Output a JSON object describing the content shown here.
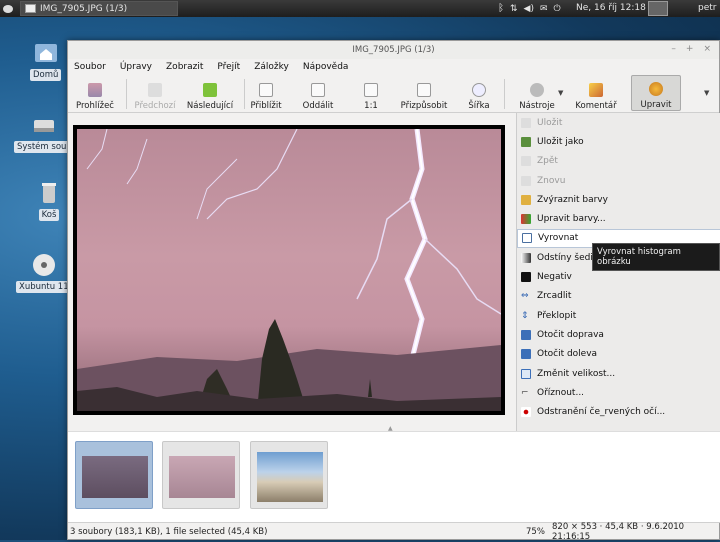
{
  "panel": {
    "task_title": "IMG_7905.JPG (1/3)",
    "clock": "Ne, 16 říj  12:18",
    "user": "petr"
  },
  "desktop": {
    "icons": [
      {
        "label": "Domů",
        "icon": "home-folder-icon"
      },
      {
        "label": "Systém soub",
        "icon": "drive-icon"
      },
      {
        "label": "Koš",
        "icon": "trash-icon"
      },
      {
        "label": "Xubuntu 11",
        "icon": "cd-icon"
      }
    ]
  },
  "window": {
    "title": "IMG_7905.JPG (1/3)",
    "menu": [
      "Soubor",
      "Úpravy",
      "Zobrazit",
      "Přejít",
      "Záložky",
      "Nápověda"
    ],
    "toolbar": {
      "browser": "Prohlížeč",
      "previous": "Předchozí",
      "next": "Následující",
      "zoom_in": "Přiblížit",
      "zoom_out": "Oddálit",
      "zoom_100": "1:1",
      "fit": "Přizpůsobit",
      "width": "Šířka",
      "tools": "Nástroje",
      "comment": "Komentář",
      "edit": "Upravit"
    },
    "side_menu": [
      {
        "label": "Uložit",
        "disabled": true,
        "icon": "save-icon"
      },
      {
        "label": "Uložit jako",
        "disabled": false,
        "icon": "save-as-icon"
      },
      {
        "label": "Zpět",
        "disabled": true,
        "icon": "undo-icon"
      },
      {
        "label": "Znovu",
        "disabled": true,
        "icon": "redo-icon"
      },
      {
        "label": "Zvýraznit barvy",
        "disabled": false,
        "icon": "enhance-colors-icon"
      },
      {
        "label": "Upravit barvy...",
        "disabled": false,
        "icon": "adjust-colors-icon"
      },
      {
        "label": "Vyrovnat",
        "disabled": false,
        "icon": "equalize-icon",
        "selected": true
      },
      {
        "label": "Odstíny šedi",
        "disabled": false,
        "icon": "grayscale-icon"
      },
      {
        "label": "Negativ",
        "disabled": false,
        "icon": "negative-icon"
      },
      {
        "label": "Zrcadlit",
        "disabled": false,
        "icon": "mirror-icon"
      },
      {
        "label": "Překlopit",
        "disabled": false,
        "icon": "flip-icon"
      },
      {
        "label": "Otočit doprava",
        "disabled": false,
        "icon": "rotate-right-icon"
      },
      {
        "label": "Otočit doleva",
        "disabled": false,
        "icon": "rotate-left-icon"
      },
      {
        "label": "Změnit velikost...",
        "disabled": false,
        "icon": "resize-icon"
      },
      {
        "label": "Oříznout...",
        "disabled": false,
        "icon": "crop-icon"
      },
      {
        "label": "Odstranění če_rvených očí...",
        "disabled": false,
        "icon": "red-eye-icon"
      }
    ],
    "tooltip": "Vyrovnat histogram obrázku",
    "status": {
      "left": "3 soubory (183,1 KB), 1 file selected (45,4 KB)",
      "zoom": "75%",
      "info": "820 × 553 · 45,4 KB · 9.6.2010 21:16:15"
    }
  }
}
